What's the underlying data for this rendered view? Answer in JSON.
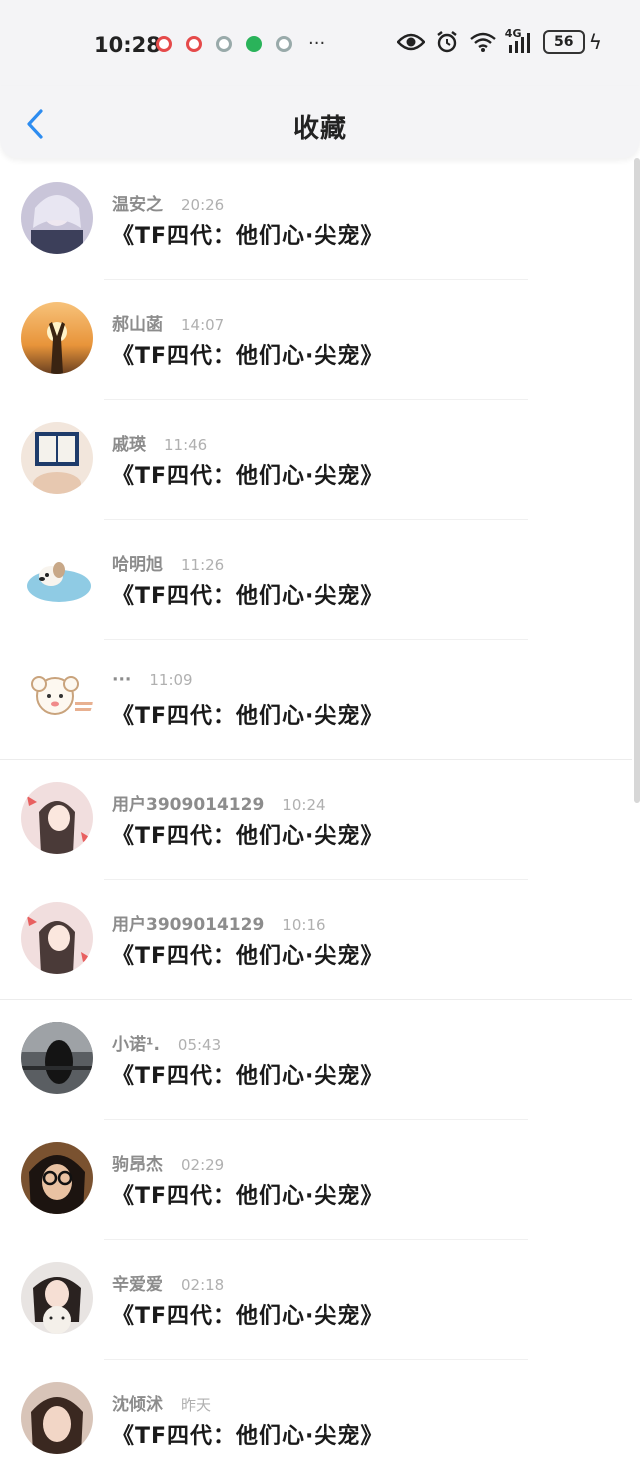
{
  "status_bar": {
    "time": "10:28",
    "more": "···",
    "network": "4G",
    "battery": "56",
    "icons": [
      "eye-icon",
      "alarm-icon",
      "wifi-icon",
      "signal-icon",
      "battery-icon",
      "charging-icon"
    ]
  },
  "header": {
    "title": "收藏",
    "back_icon": "chevron-left-icon",
    "back_color": "#2d8cf0"
  },
  "items": [
    {
      "name": "温安之",
      "time": "20:26",
      "content": "《TF四代：他们心·尖宠》",
      "avatar": "anime-boy-avatar"
    },
    {
      "name": "郝山菡",
      "time": "14:07",
      "content": "《TF四代：他们心·尖宠》",
      "avatar": "sunset-avatar"
    },
    {
      "name": "戚瑛",
      "time": "11:46",
      "content": "《TF四代：他们心·尖宠》",
      "avatar": "book-avatar"
    },
    {
      "name": "哈明旭",
      "time": "11:26",
      "content": "《TF四代：他们心·尖宠》",
      "avatar": "puppy-avatar"
    },
    {
      "name": "···",
      "time": "11:09",
      "content": "《TF四代：他们心·尖宠》",
      "avatar": "sheep-avatar"
    },
    {
      "name": "用户3909014129",
      "time": "10:24",
      "content": "《TF四代：他们心·尖宠》",
      "avatar": "anime-girl-avatar"
    },
    {
      "name": "用户3909014129",
      "time": "10:16",
      "content": "《TF四代：他们心·尖宠》",
      "avatar": "anime-girl-avatar"
    },
    {
      "name": "小诺¹.",
      "time": "05:43",
      "content": "《TF四代：他们心·尖宠》",
      "avatar": "silhouette-avatar"
    },
    {
      "name": "驹昂杰",
      "time": "02:29",
      "content": "《TF四代：他们心·尖宠》",
      "avatar": "glasses-avatar"
    },
    {
      "name": "辛爱爱",
      "time": "02:18",
      "content": "《TF四代：他们心·尖宠》",
      "avatar": "doll-avatar"
    },
    {
      "name": "沈倾沭",
      "time": "昨天",
      "content": "《TF四代：他们心·尖宠》",
      "avatar": "portrait-avatar"
    }
  ]
}
